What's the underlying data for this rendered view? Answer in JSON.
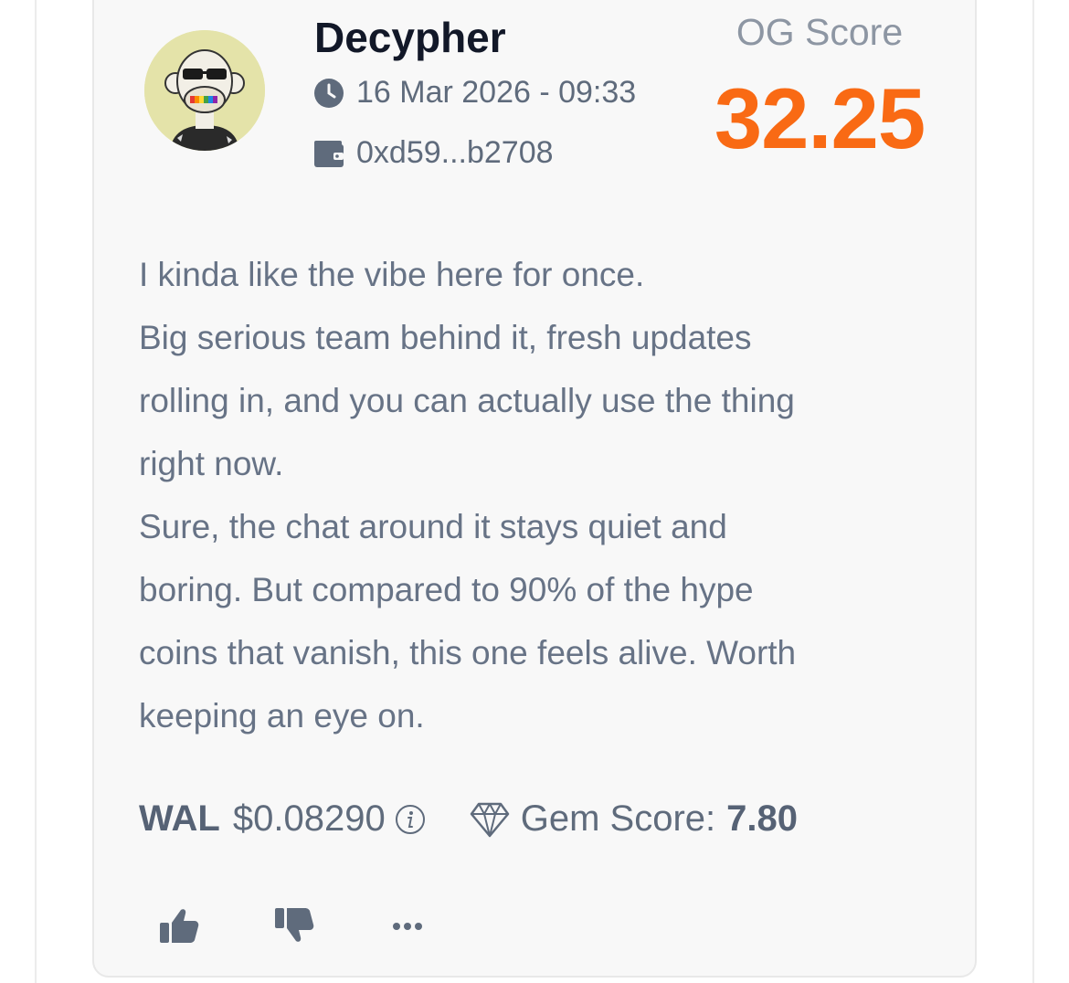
{
  "post": {
    "username": "Decypher",
    "datetime": "16 Mar 2026 - 09:33",
    "wallet": "0xd59...b2708",
    "avatar_icon": "ape-avatar",
    "og_score_label": "OG Score",
    "og_score_value": "32.25",
    "body_lines": [
      "I kinda like the vibe here for once.",
      "Big serious team behind it, fresh updates",
      "rolling in, and you can actually use the thing",
      "right now.",
      "Sure, the chat around it stays quiet and",
      "boring. But compared to 90% of the hype",
      "coins that vanish, this one feels alive. Worth",
      "keeping an eye on."
    ]
  },
  "token": {
    "symbol": "WAL",
    "price": "$0.08290",
    "gem_label": "Gem Score:",
    "gem_value": "7.80"
  },
  "actions": {
    "like_icon": "thumbs-up-icon",
    "dislike_icon": "thumbs-down-icon",
    "more_icon": "ellipsis-icon"
  },
  "colors": {
    "og_score": "#f96a14",
    "text_primary": "#121828",
    "text_secondary": "#677386",
    "card_bg": "#f8f8f8",
    "avatar_bg": "#e4e3a9"
  }
}
